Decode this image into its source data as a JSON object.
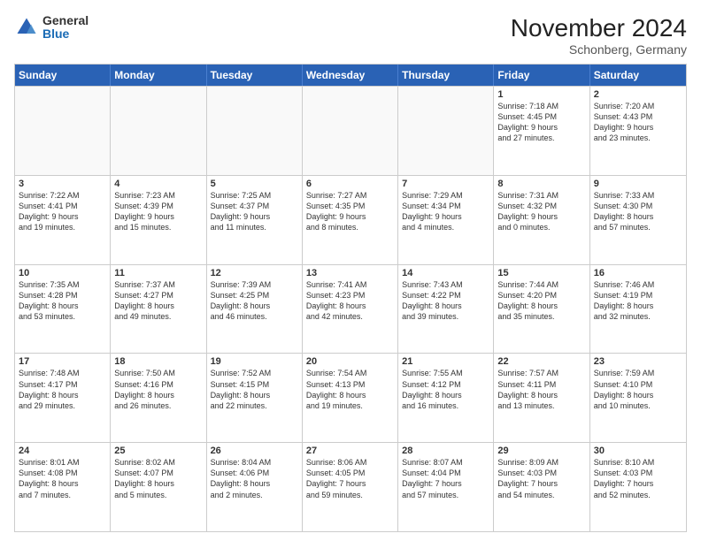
{
  "header": {
    "logo": {
      "general": "General",
      "blue": "Blue"
    },
    "title": "November 2024",
    "subtitle": "Schonberg, Germany"
  },
  "weekdays": [
    "Sunday",
    "Monday",
    "Tuesday",
    "Wednesday",
    "Thursday",
    "Friday",
    "Saturday"
  ],
  "weeks": [
    [
      {
        "day": "",
        "empty": true
      },
      {
        "day": "",
        "empty": true
      },
      {
        "day": "",
        "empty": true
      },
      {
        "day": "",
        "empty": true
      },
      {
        "day": "",
        "empty": true
      },
      {
        "day": "1",
        "info": "Sunrise: 7:18 AM\nSunset: 4:45 PM\nDaylight: 9 hours\nand 27 minutes."
      },
      {
        "day": "2",
        "info": "Sunrise: 7:20 AM\nSunset: 4:43 PM\nDaylight: 9 hours\nand 23 minutes."
      }
    ],
    [
      {
        "day": "3",
        "info": "Sunrise: 7:22 AM\nSunset: 4:41 PM\nDaylight: 9 hours\nand 19 minutes."
      },
      {
        "day": "4",
        "info": "Sunrise: 7:23 AM\nSunset: 4:39 PM\nDaylight: 9 hours\nand 15 minutes."
      },
      {
        "day": "5",
        "info": "Sunrise: 7:25 AM\nSunset: 4:37 PM\nDaylight: 9 hours\nand 11 minutes."
      },
      {
        "day": "6",
        "info": "Sunrise: 7:27 AM\nSunset: 4:35 PM\nDaylight: 9 hours\nand 8 minutes."
      },
      {
        "day": "7",
        "info": "Sunrise: 7:29 AM\nSunset: 4:34 PM\nDaylight: 9 hours\nand 4 minutes."
      },
      {
        "day": "8",
        "info": "Sunrise: 7:31 AM\nSunset: 4:32 PM\nDaylight: 9 hours\nand 0 minutes."
      },
      {
        "day": "9",
        "info": "Sunrise: 7:33 AM\nSunset: 4:30 PM\nDaylight: 8 hours\nand 57 minutes."
      }
    ],
    [
      {
        "day": "10",
        "info": "Sunrise: 7:35 AM\nSunset: 4:28 PM\nDaylight: 8 hours\nand 53 minutes."
      },
      {
        "day": "11",
        "info": "Sunrise: 7:37 AM\nSunset: 4:27 PM\nDaylight: 8 hours\nand 49 minutes."
      },
      {
        "day": "12",
        "info": "Sunrise: 7:39 AM\nSunset: 4:25 PM\nDaylight: 8 hours\nand 46 minutes."
      },
      {
        "day": "13",
        "info": "Sunrise: 7:41 AM\nSunset: 4:23 PM\nDaylight: 8 hours\nand 42 minutes."
      },
      {
        "day": "14",
        "info": "Sunrise: 7:43 AM\nSunset: 4:22 PM\nDaylight: 8 hours\nand 39 minutes."
      },
      {
        "day": "15",
        "info": "Sunrise: 7:44 AM\nSunset: 4:20 PM\nDaylight: 8 hours\nand 35 minutes."
      },
      {
        "day": "16",
        "info": "Sunrise: 7:46 AM\nSunset: 4:19 PM\nDaylight: 8 hours\nand 32 minutes."
      }
    ],
    [
      {
        "day": "17",
        "info": "Sunrise: 7:48 AM\nSunset: 4:17 PM\nDaylight: 8 hours\nand 29 minutes."
      },
      {
        "day": "18",
        "info": "Sunrise: 7:50 AM\nSunset: 4:16 PM\nDaylight: 8 hours\nand 26 minutes."
      },
      {
        "day": "19",
        "info": "Sunrise: 7:52 AM\nSunset: 4:15 PM\nDaylight: 8 hours\nand 22 minutes."
      },
      {
        "day": "20",
        "info": "Sunrise: 7:54 AM\nSunset: 4:13 PM\nDaylight: 8 hours\nand 19 minutes."
      },
      {
        "day": "21",
        "info": "Sunrise: 7:55 AM\nSunset: 4:12 PM\nDaylight: 8 hours\nand 16 minutes."
      },
      {
        "day": "22",
        "info": "Sunrise: 7:57 AM\nSunset: 4:11 PM\nDaylight: 8 hours\nand 13 minutes."
      },
      {
        "day": "23",
        "info": "Sunrise: 7:59 AM\nSunset: 4:10 PM\nDaylight: 8 hours\nand 10 minutes."
      }
    ],
    [
      {
        "day": "24",
        "info": "Sunrise: 8:01 AM\nSunset: 4:08 PM\nDaylight: 8 hours\nand 7 minutes."
      },
      {
        "day": "25",
        "info": "Sunrise: 8:02 AM\nSunset: 4:07 PM\nDaylight: 8 hours\nand 5 minutes."
      },
      {
        "day": "26",
        "info": "Sunrise: 8:04 AM\nSunset: 4:06 PM\nDaylight: 8 hours\nand 2 minutes."
      },
      {
        "day": "27",
        "info": "Sunrise: 8:06 AM\nSunset: 4:05 PM\nDaylight: 7 hours\nand 59 minutes."
      },
      {
        "day": "28",
        "info": "Sunrise: 8:07 AM\nSunset: 4:04 PM\nDaylight: 7 hours\nand 57 minutes."
      },
      {
        "day": "29",
        "info": "Sunrise: 8:09 AM\nSunset: 4:03 PM\nDaylight: 7 hours\nand 54 minutes."
      },
      {
        "day": "30",
        "info": "Sunrise: 8:10 AM\nSunset: 4:03 PM\nDaylight: 7 hours\nand 52 minutes."
      }
    ]
  ]
}
